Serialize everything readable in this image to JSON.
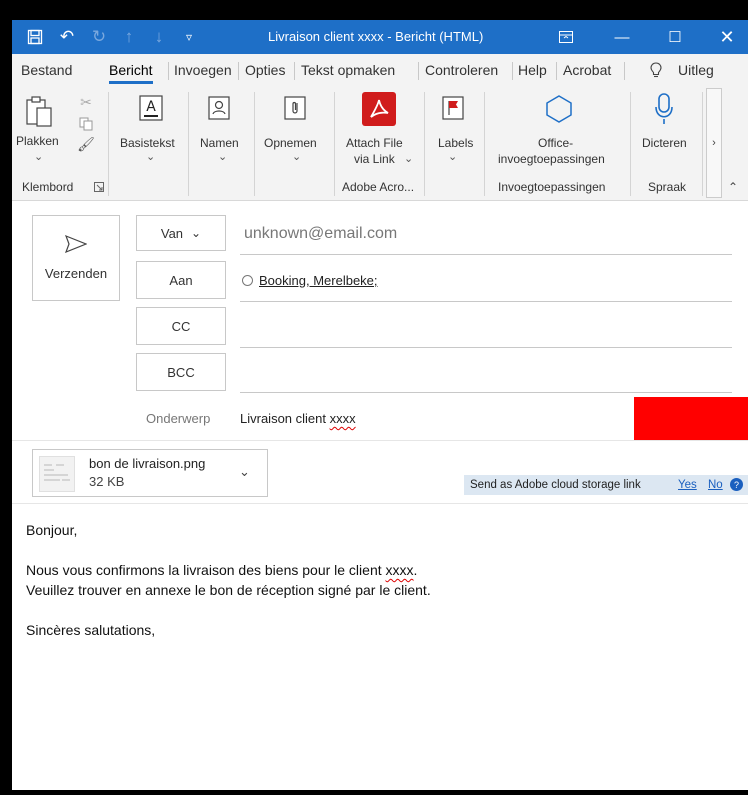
{
  "titlebar": {
    "title": "Livraison client xxxx  -  Bericht (HTML)",
    "bg_color": "#1e6fc7"
  },
  "menu": {
    "items": [
      "Bestand",
      "Bericht",
      "Invoegen",
      "Opties",
      "Tekst opmaken",
      "Controleren",
      "Help",
      "Acrobat"
    ],
    "active": "Bericht",
    "tell_me": "Uitleg"
  },
  "ribbon": {
    "paste": "Plakken",
    "clipboard_group": "Klembord",
    "basic_text": "Basistekst",
    "names": "Namen",
    "include": "Opnemen",
    "attach_link_line1": "Attach File",
    "attach_link_line2": "via Link",
    "adobe_group": "Adobe Acro...",
    "tags": "Labels",
    "office_addins_line1": "Office-",
    "office_addins_line2": "invoegtoepassingen",
    "addins_group": "Invoegtoepassingen",
    "dictate": "Dicteren",
    "speech_group": "Spraak"
  },
  "compose": {
    "send": "Verzenden",
    "from_label": "Van",
    "from_value": "unknown@email.com",
    "to_label": "Aan",
    "to_value": "Booking, Merelbeke;",
    "cc_label": "CC",
    "bcc_label": "BCC",
    "subject_label": "Onderwerp",
    "subject_value_prefix": "Livraison client ",
    "subject_value_xxxx": "xxxx",
    "redaction_color": "#ff0000"
  },
  "attachment": {
    "name": "bon de livraison.png",
    "size": "32 KB",
    "cloud_prompt": "Send as Adobe cloud storage link",
    "yes": "Yes",
    "no": "No"
  },
  "body": {
    "greeting": "Bonjour,",
    "line1_prefix": "Nous vous confirmons la livraison des biens pour le client ",
    "line1_xxxx": "xxxx",
    "line1_suffix": ".",
    "line2": "Veuillez trouver en annexe le bon de réception signé par le client.",
    "closing": "Sincères salutations,"
  }
}
